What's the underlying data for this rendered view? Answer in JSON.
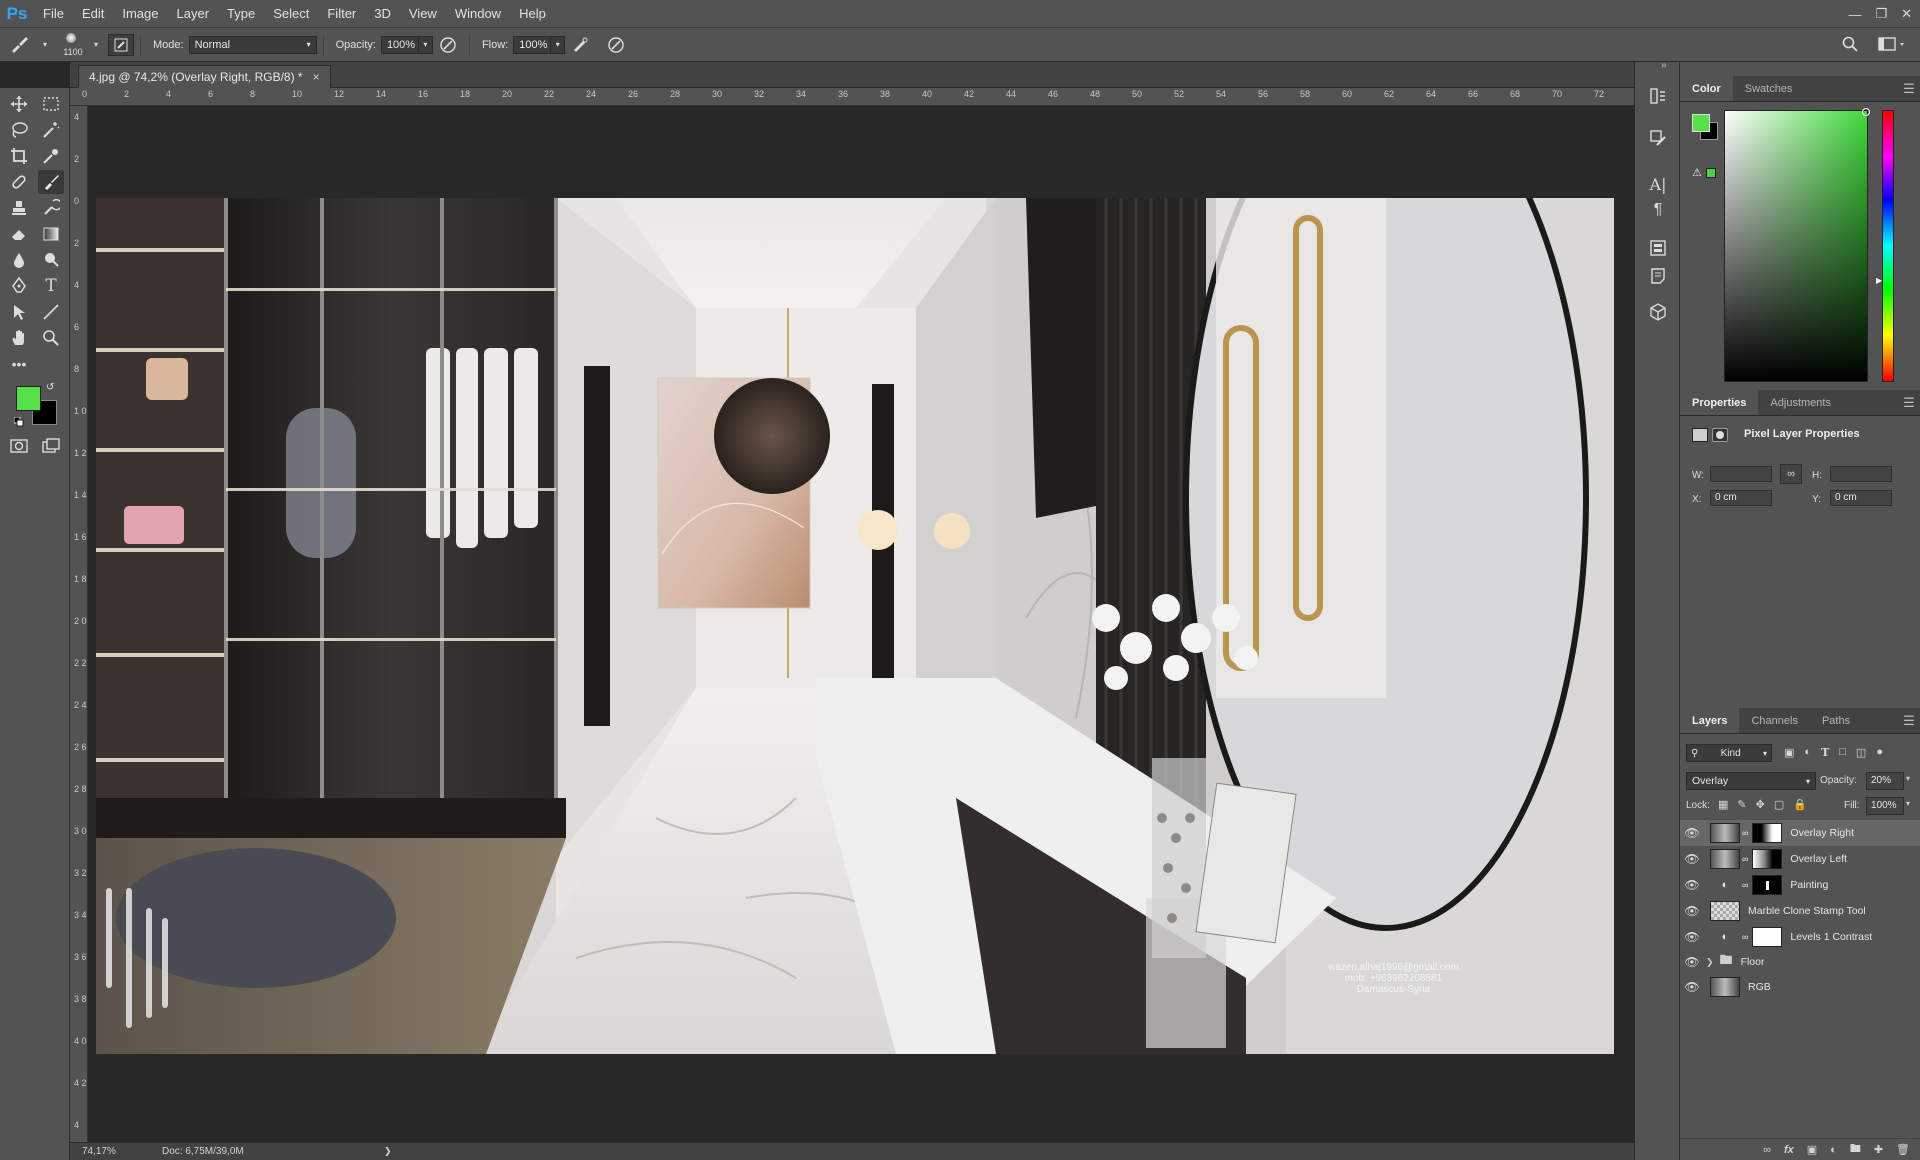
{
  "app": {
    "logo": "Ps"
  },
  "menubar": {
    "items": [
      "File",
      "Edit",
      "Image",
      "Layer",
      "Type",
      "Select",
      "Filter",
      "3D",
      "View",
      "Window",
      "Help"
    ],
    "window_controls": [
      "minimize-icon",
      "restore-icon",
      "close-icon"
    ]
  },
  "options": {
    "brush_size": "1100",
    "mode_label": "Mode:",
    "mode_value": "Normal",
    "opacity_label": "Opacity:",
    "opacity_value": "100%",
    "flow_label": "Flow:",
    "flow_value": "100%"
  },
  "document": {
    "tab_title": "4.jpg @ 74,2% (Overlay Right, RGB/8) *",
    "close": "×",
    "zoom": "74,17%",
    "doc_info": "Doc: 6,75M/39,0M",
    "status_arrow": "❯"
  },
  "rulers": {
    "top": [
      "0",
      "2",
      "4",
      "6",
      "8",
      "10",
      "12",
      "14",
      "16",
      "18",
      "20",
      "22",
      "24",
      "26",
      "28",
      "30",
      "32",
      "34",
      "36",
      "38",
      "40",
      "42",
      "44",
      "46",
      "48",
      "50",
      "52",
      "54",
      "56",
      "58",
      "60",
      "62",
      "64",
      "66",
      "68",
      "70",
      "72"
    ],
    "left": [
      "4",
      "2",
      "0",
      "2",
      "4",
      "6",
      "8",
      "1 0",
      "1 2",
      "1 4",
      "1 6",
      "1 8",
      "2 0",
      "2 2",
      "2 4",
      "2 6",
      "2 8",
      "3 0",
      "3 2",
      "3 4",
      "3 6",
      "3 8",
      "4 0",
      "4 2",
      "4"
    ]
  },
  "artwork": {
    "watermark_lines": [
      "wazen.alhaj1996@gmail.com",
      "mob: +963962208581",
      "Damascus-Syria"
    ]
  },
  "colors": {
    "foreground": "#55e04a",
    "background": "#000000",
    "picker_hue": "#3fd83a",
    "accent": "#31a8ff"
  },
  "color_panel": {
    "tabs": [
      "Color",
      "Swatches"
    ]
  },
  "properties_panel": {
    "tabs": [
      "Properties",
      "Adjustments"
    ],
    "title": "Pixel Layer Properties",
    "w_label": "W:",
    "h_label": "H:",
    "x_label": "X:",
    "x_value": "0 cm",
    "y_label": "Y:",
    "y_value": "0 cm"
  },
  "layers_panel": {
    "tabs": [
      "Layers",
      "Channels",
      "Paths"
    ],
    "filter_kind": "Kind",
    "blend_mode": "Overlay",
    "opacity_label": "Opacity:",
    "opacity_value": "20%",
    "lock_label": "Lock:",
    "fill_label": "Fill:",
    "fill_value": "100%",
    "layers": [
      {
        "name": "Overlay Right",
        "selected": true,
        "kind": "pixel-mask"
      },
      {
        "name": "Overlay Left",
        "selected": false,
        "kind": "pixel-mask"
      },
      {
        "name": "Painting",
        "selected": false,
        "kind": "adjustment"
      },
      {
        "name": "Marble Clone Stamp Tool",
        "selected": false,
        "kind": "transparent"
      },
      {
        "name": "Levels 1 Contrast",
        "selected": false,
        "kind": "adjustment"
      },
      {
        "name": "Floor",
        "selected": false,
        "kind": "group"
      },
      {
        "name": "RGB",
        "selected": false,
        "kind": "pixel"
      }
    ]
  }
}
